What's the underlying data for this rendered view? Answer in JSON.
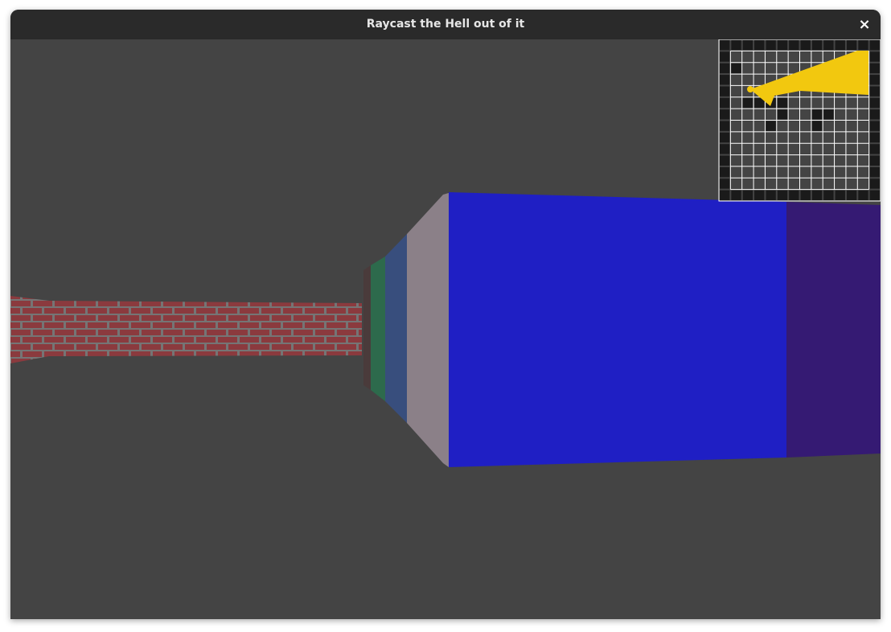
{
  "window": {
    "title": "Raycast the Hell out of it",
    "close_glyph": "×"
  },
  "colors": {
    "titlebar": "#2a2a2a",
    "title_text": "#e6e6e6",
    "background": "#444444",
    "brick": "#8b3a3e",
    "mortar": "#757575",
    "wall_blue": "#1f1fc4",
    "wall_purple": "#351a73",
    "wall_grey": "#8b8088",
    "wall_slate": "#384e7d",
    "wall_green": "#2d6a4c",
    "wall_brown": "#4a3b3b",
    "minimap_wall": "#1a1a1a",
    "minimap_floor": "#444444",
    "minimap_grid": "#ffffff",
    "ray_cone": "#f2c80f"
  },
  "minimap": {
    "cols": 14,
    "rows": 14,
    "wall_cells": [
      [
        1,
        2
      ],
      [
        2,
        5
      ],
      [
        3,
        5
      ],
      [
        4,
        5
      ],
      [
        5,
        5
      ],
      [
        5,
        6
      ],
      [
        4,
        7
      ],
      [
        8,
        6
      ],
      [
        9,
        6
      ],
      [
        8,
        7
      ]
    ],
    "player_cell": [
      3.2,
      4.2
    ]
  }
}
